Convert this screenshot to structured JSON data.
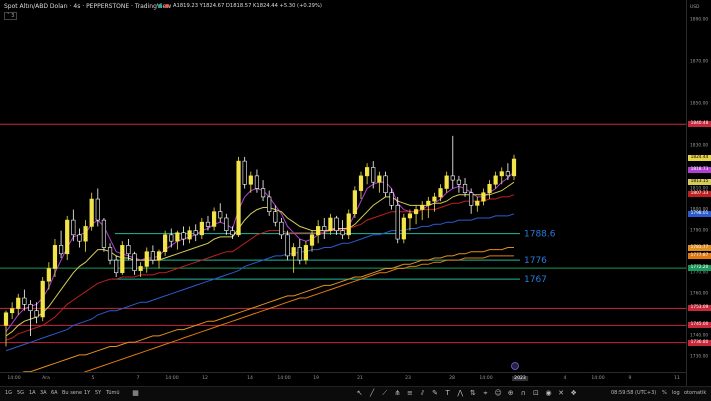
{
  "legend": {
    "title": "Spot Altın/ABD Doları · 4s · PEPPERSTONE · TradingView",
    "ohlc": "A1819.23  Y1824.67  D1818.57  K1824.44  +5.30 (+0.29%)",
    "collapse": "3",
    "dot_colors": [
      "#26a69a",
      "#ef5350"
    ]
  },
  "price_scale": {
    "currency": "USD",
    "labels": [
      "1890.00",
      "1870.00",
      "1850.00",
      "1830.00",
      "1810.00",
      "1800.00",
      "1790.00",
      "1770.00",
      "1760.00",
      "1740.00",
      "1730.00"
    ],
    "label_values": [
      1890,
      1870,
      1850,
      1830,
      1810,
      1800,
      1790,
      1770,
      1760,
      1740,
      1730
    ],
    "tags": [
      {
        "text": "1840.48",
        "value": 1840.48,
        "color": "#c6283c"
      },
      {
        "text": "1824.44",
        "value": 1824.44,
        "color": "#e6d44a"
      },
      {
        "text": "1818.73",
        "value": 1818.73,
        "color": "#b040d0"
      },
      {
        "text": "1813.15",
        "value": 1813.15,
        "color": "#d4cc55"
      },
      {
        "text": "1807.33",
        "value": 1807.33,
        "color": "#c02020"
      },
      {
        "text": "1798.01",
        "value": 1798.01,
        "color": "#2a5cd0"
      },
      {
        "text": "1781.77",
        "value": 1781.77,
        "color": "#e0901e"
      },
      {
        "text": "1777.87",
        "value": 1777.87,
        "color": "#e07a10"
      },
      {
        "text": "1772.20",
        "value": 1772.2,
        "color": "#1a9a5a"
      },
      {
        "text": "1753.09",
        "value": 1753.09,
        "color": "#c6283c"
      },
      {
        "text": "1745.00",
        "value": 1745.0,
        "color": "#c6283c"
      },
      {
        "text": "1736.80",
        "value": 1736.8,
        "color": "#c6283c"
      }
    ]
  },
  "time_axis": {
    "labels": [
      "14:00",
      "Ara",
      "5",
      "7",
      "14:00",
      "12",
      "14",
      "14:00",
      "19",
      "21",
      "23",
      "28",
      "14:00",
      "2023",
      "4",
      "14:00",
      "9",
      "11"
    ],
    "highlight": "2023"
  },
  "chart_data": {
    "type": "candlestick",
    "y_range": [
      1728,
      1900
    ],
    "candles": [
      [
        1745,
        1752,
        1735,
        1751
      ],
      [
        1751,
        1756,
        1748,
        1753
      ],
      [
        1753,
        1760,
        1750,
        1758
      ],
      [
        1758,
        1762,
        1752,
        1755
      ],
      [
        1755,
        1757,
        1740,
        1752
      ],
      [
        1752,
        1756,
        1746,
        1749
      ],
      [
        1749,
        1768,
        1747,
        1766
      ],
      [
        1766,
        1775,
        1762,
        1772
      ],
      [
        1772,
        1786,
        1768,
        1783
      ],
      [
        1783,
        1790,
        1777,
        1779
      ],
      [
        1779,
        1797,
        1776,
        1795
      ],
      [
        1795,
        1800,
        1785,
        1788
      ],
      [
        1788,
        1791,
        1782,
        1785
      ],
      [
        1785,
        1795,
        1780,
        1792
      ],
      [
        1792,
        1808,
        1790,
        1805
      ],
      [
        1805,
        1810,
        1792,
        1795
      ],
      [
        1795,
        1796,
        1780,
        1782
      ],
      [
        1782,
        1784,
        1774,
        1776
      ],
      [
        1776,
        1778,
        1768,
        1770
      ],
      [
        1770,
        1785,
        1769,
        1783
      ],
      [
        1783,
        1786,
        1776,
        1779
      ],
      [
        1779,
        1780,
        1769,
        1771
      ],
      [
        1771,
        1775,
        1768,
        1773
      ],
      [
        1773,
        1782,
        1770,
        1780
      ],
      [
        1780,
        1783,
        1774,
        1776
      ],
      [
        1776,
        1781,
        1772,
        1780
      ],
      [
        1780,
        1790,
        1778,
        1788
      ],
      [
        1788,
        1791,
        1782,
        1785
      ],
      [
        1785,
        1790,
        1781,
        1789
      ],
      [
        1789,
        1792,
        1783,
        1786
      ],
      [
        1786,
        1792,
        1784,
        1790
      ],
      [
        1790,
        1793,
        1785,
        1788
      ],
      [
        1788,
        1796,
        1786,
        1794
      ],
      [
        1794,
        1797,
        1790,
        1792
      ],
      [
        1792,
        1801,
        1790,
        1799
      ],
      [
        1799,
        1803,
        1794,
        1796
      ],
      [
        1796,
        1798,
        1788,
        1790
      ],
      [
        1790,
        1792,
        1786,
        1788
      ],
      [
        1788,
        1825,
        1787,
        1823
      ],
      [
        1823,
        1825,
        1810,
        1812
      ],
      [
        1812,
        1818,
        1808,
        1816
      ],
      [
        1816,
        1819,
        1808,
        1810
      ],
      [
        1810,
        1814,
        1804,
        1806
      ],
      [
        1806,
        1809,
        1797,
        1799
      ],
      [
        1799,
        1802,
        1792,
        1794
      ],
      [
        1794,
        1796,
        1786,
        1788
      ],
      [
        1788,
        1790,
        1776,
        1778
      ],
      [
        1778,
        1784,
        1770,
        1782
      ],
      [
        1782,
        1786,
        1774,
        1776
      ],
      [
        1776,
        1785,
        1774,
        1783
      ],
      [
        1783,
        1790,
        1780,
        1788
      ],
      [
        1788,
        1795,
        1784,
        1792
      ],
      [
        1792,
        1796,
        1786,
        1790
      ],
      [
        1790,
        1798,
        1788,
        1796
      ],
      [
        1796,
        1797,
        1788,
        1790
      ],
      [
        1790,
        1795,
        1786,
        1788
      ],
      [
        1788,
        1800,
        1786,
        1798
      ],
      [
        1798,
        1811,
        1796,
        1809
      ],
      [
        1809,
        1818,
        1805,
        1816
      ],
      [
        1816,
        1822,
        1812,
        1820
      ],
      [
        1820,
        1823,
        1810,
        1813
      ],
      [
        1813,
        1818,
        1808,
        1816
      ],
      [
        1816,
        1818,
        1806,
        1808
      ],
      [
        1808,
        1810,
        1800,
        1802
      ],
      [
        1802,
        1806,
        1784,
        1786
      ],
      [
        1786,
        1798,
        1784,
        1796
      ],
      [
        1796,
        1800,
        1790,
        1798
      ],
      [
        1798,
        1802,
        1793,
        1800
      ],
      [
        1800,
        1804,
        1795,
        1802
      ],
      [
        1802,
        1806,
        1796,
        1804
      ],
      [
        1804,
        1808,
        1799,
        1806
      ],
      [
        1806,
        1812,
        1804,
        1810
      ],
      [
        1810,
        1818,
        1808,
        1816
      ],
      [
        1816,
        1835,
        1810,
        1814
      ],
      [
        1814,
        1816,
        1808,
        1812
      ],
      [
        1812,
        1815,
        1806,
        1808
      ],
      [
        1808,
        1810,
        1798,
        1802
      ],
      [
        1802,
        1806,
        1799,
        1804
      ],
      [
        1804,
        1810,
        1802,
        1808
      ],
      [
        1808,
        1814,
        1805,
        1812
      ],
      [
        1812,
        1818,
        1810,
        1816
      ],
      [
        1816,
        1820,
        1812,
        1818
      ],
      [
        1818,
        1822,
        1814,
        1816
      ],
      [
        1816,
        1826,
        1814,
        1824
      ]
    ],
    "ma_lines": [
      {
        "color": "#b040d0",
        "values": [
          1742,
          1746,
          1750,
          1753,
          1754,
          1755,
          1758,
          1763,
          1770,
          1776,
          1782,
          1787,
          1788,
          1789,
          1793,
          1795,
          1792,
          1786,
          1780,
          1779,
          1778,
          1777,
          1776,
          1777,
          1777,
          1778,
          1781,
          1783,
          1785,
          1786,
          1787,
          1788,
          1790,
          1791,
          1793,
          1794,
          1793,
          1791,
          1800,
          1806,
          1809,
          1810,
          1809,
          1806,
          1802,
          1798,
          1792,
          1789,
          1786,
          1785,
          1786,
          1788,
          1789,
          1791,
          1791,
          1790,
          1792,
          1798,
          1804,
          1810,
          1812,
          1813,
          1813,
          1810,
          1803,
          1800,
          1799,
          1799,
          1800,
          1802,
          1803,
          1805,
          1808,
          1810,
          1811,
          1810,
          1808,
          1806,
          1806,
          1808,
          1810,
          1813,
          1815,
          1818
        ]
      },
      {
        "color": "#d4cc55",
        "values": [
          1740,
          1742,
          1745,
          1747,
          1748,
          1749,
          1751,
          1754,
          1758,
          1762,
          1766,
          1770,
          1773,
          1775,
          1778,
          1781,
          1781,
          1780,
          1778,
          1777,
          1777,
          1776,
          1776,
          1776,
          1776,
          1776,
          1777,
          1778,
          1779,
          1780,
          1781,
          1782,
          1783,
          1784,
          1786,
          1787,
          1787,
          1787,
          1791,
          1795,
          1798,
          1800,
          1801,
          1801,
          1800,
          1799,
          1796,
          1794,
          1792,
          1791,
          1790,
          1790,
          1790,
          1790,
          1791,
          1791,
          1791,
          1793,
          1796,
          1799,
          1802,
          1804,
          1806,
          1806,
          1804,
          1803,
          1802,
          1802,
          1802,
          1802,
          1803,
          1803,
          1804,
          1806,
          1807,
          1807,
          1807,
          1807,
          1807,
          1807,
          1808,
          1809,
          1811,
          1813
        ]
      },
      {
        "color": "#c02020",
        "values": [
          1738,
          1739,
          1741,
          1742,
          1743,
          1744,
          1745,
          1747,
          1749,
          1752,
          1755,
          1757,
          1759,
          1761,
          1763,
          1765,
          1766,
          1767,
          1767,
          1768,
          1768,
          1768,
          1769,
          1769,
          1769,
          1770,
          1770,
          1771,
          1772,
          1773,
          1774,
          1775,
          1776,
          1777,
          1778,
          1779,
          1780,
          1780,
          1782,
          1784,
          1786,
          1788,
          1789,
          1790,
          1790,
          1790,
          1789,
          1789,
          1789,
          1789,
          1789,
          1789,
          1789,
          1790,
          1790,
          1790,
          1791,
          1792,
          1793,
          1795,
          1796,
          1797,
          1798,
          1799,
          1799,
          1799,
          1799,
          1799,
          1800,
          1800,
          1800,
          1801,
          1802,
          1803,
          1803,
          1804,
          1804,
          1804,
          1804,
          1805,
          1805,
          1806,
          1806,
          1807
        ]
      },
      {
        "color": "#2a5cd0",
        "values": [
          1733,
          1734,
          1735,
          1736,
          1737,
          1738,
          1739,
          1740,
          1741,
          1742,
          1743,
          1745,
          1746,
          1747,
          1748,
          1750,
          1751,
          1752,
          1752,
          1753,
          1754,
          1755,
          1756,
          1756,
          1757,
          1758,
          1759,
          1760,
          1761,
          1762,
          1763,
          1764,
          1765,
          1766,
          1767,
          1768,
          1769,
          1770,
          1771,
          1773,
          1774,
          1775,
          1776,
          1777,
          1778,
          1778,
          1779,
          1779,
          1780,
          1780,
          1781,
          1781,
          1782,
          1782,
          1783,
          1784,
          1784,
          1785,
          1786,
          1787,
          1788,
          1788,
          1789,
          1790,
          1790,
          1790,
          1791,
          1791,
          1792,
          1792,
          1793,
          1793,
          1794,
          1794,
          1795,
          1795,
          1795,
          1796,
          1796,
          1796,
          1797,
          1797,
          1797,
          1798
        ]
      },
      {
        "color": "#e0901e",
        "values": [
          1720,
          1721,
          1722,
          1723,
          1723,
          1724,
          1725,
          1726,
          1727,
          1728,
          1729,
          1730,
          1731,
          1731,
          1732,
          1733,
          1734,
          1735,
          1735,
          1736,
          1737,
          1737,
          1738,
          1739,
          1740,
          1740,
          1741,
          1742,
          1743,
          1743,
          1744,
          1745,
          1746,
          1747,
          1747,
          1748,
          1749,
          1750,
          1751,
          1752,
          1753,
          1754,
          1755,
          1756,
          1757,
          1758,
          1759,
          1759,
          1760,
          1761,
          1762,
          1763,
          1764,
          1764,
          1765,
          1766,
          1767,
          1768,
          1768,
          1769,
          1770,
          1771,
          1772,
          1772,
          1773,
          1774,
          1774,
          1775,
          1776,
          1776,
          1777,
          1777,
          1778,
          1778,
          1779,
          1779,
          1780,
          1780,
          1780,
          1781,
          1781,
          1781,
          1782,
          1782
        ]
      },
      {
        "color": "#e07a10",
        "values": [
          1710,
          1711,
          1712,
          1713,
          1714,
          1715,
          1716,
          1717,
          1718,
          1719,
          1720,
          1721,
          1722,
          1723,
          1724,
          1725,
          1726,
          1727,
          1728,
          1729,
          1730,
          1731,
          1732,
          1733,
          1734,
          1735,
          1736,
          1737,
          1738,
          1739,
          1740,
          1741,
          1742,
          1743,
          1744,
          1745,
          1746,
          1747,
          1748,
          1749,
          1750,
          1751,
          1752,
          1753,
          1754,
          1755,
          1756,
          1757,
          1758,
          1758,
          1759,
          1760,
          1761,
          1762,
          1763,
          1764,
          1765,
          1766,
          1767,
          1768,
          1769,
          1770,
          1770,
          1771,
          1772,
          1772,
          1773,
          1773,
          1774,
          1774,
          1775,
          1775,
          1776,
          1776,
          1776,
          1777,
          1777,
          1777,
          1777,
          1778,
          1778,
          1778,
          1778,
          1778
        ]
      }
    ],
    "hlines": [
      {
        "value": 1840.48,
        "color": "#c6283c"
      },
      {
        "value": 1772.2,
        "color": "#1a9a5a"
      },
      {
        "value": 1753.09,
        "color": "#c6283c"
      },
      {
        "value": 1745.0,
        "color": "#c6283c"
      },
      {
        "value": 1736.8,
        "color": "#c6283c"
      }
    ],
    "levels": [
      {
        "label": "1788.6",
        "value": 1788.6
      },
      {
        "label": "1776",
        "value": 1776
      },
      {
        "label": "1767",
        "value": 1767
      }
    ],
    "level_color": "#1fb89a",
    "level_label_color": "#2a7adc"
  },
  "toolbar": {
    "timeframes": [
      "1G",
      "5G",
      "1A",
      "3A",
      "6A",
      "Bu sene",
      "1Y",
      "5Y",
      "Tümü"
    ],
    "time": "08:59:58 (UTC+3)",
    "percent": "%",
    "log": "log",
    "auto": "otomatik"
  }
}
